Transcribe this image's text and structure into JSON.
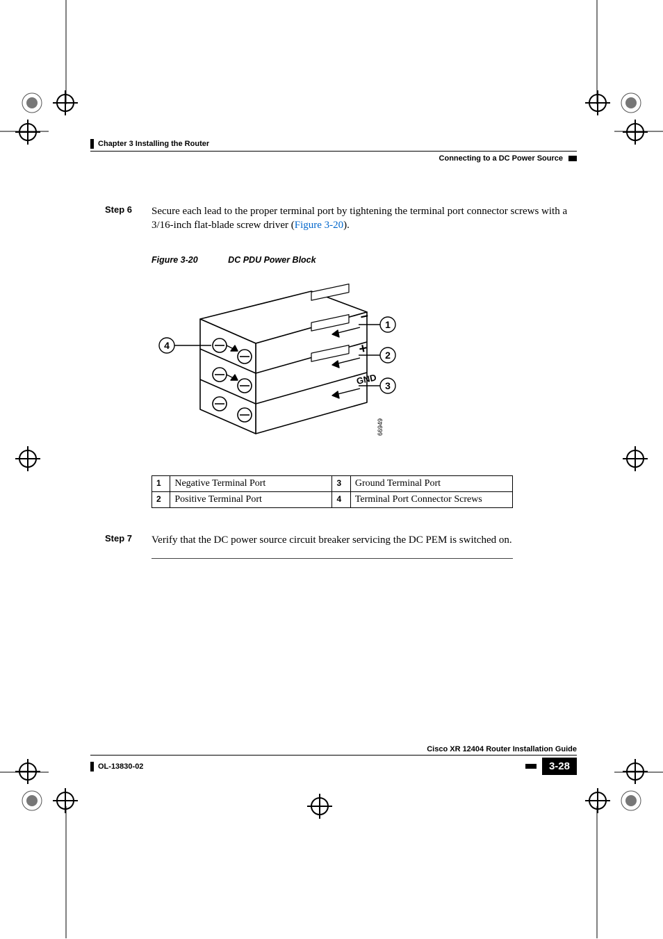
{
  "header": {
    "chapter": "Chapter 3      Installing the Router",
    "section": "Connecting to a DC Power Source"
  },
  "steps": {
    "step6": {
      "label": "Step 6",
      "text_before_link": "Secure each lead to the proper terminal port by tightening the terminal port connector screws with a 3/16-inch flat-blade screw driver (",
      "link_text": "Figure 3-20",
      "text_after_link": ")."
    },
    "step7": {
      "label": "Step 7",
      "text": "Verify that the DC power source circuit breaker servicing the DC PEM is switched on."
    }
  },
  "figure": {
    "number": "Figure 3-20",
    "title": "DC PDU Power Block",
    "callouts": {
      "c1": "1",
      "c2": "2",
      "c3": "3",
      "c4": "4"
    },
    "labels": {
      "minus": "−",
      "plus": "+",
      "gnd": "GND"
    },
    "art_id": "66949"
  },
  "legend": {
    "r1c1_num": "1",
    "r1c1_desc": "Negative Terminal Port",
    "r1c2_num": "3",
    "r1c2_desc": "Ground Terminal Port",
    "r2c1_num": "2",
    "r2c1_desc": "Positive Terminal Port",
    "r2c2_num": "4",
    "r2c2_desc": "Terminal Port Connector Screws"
  },
  "footer": {
    "guide": "Cisco XR 12404 Router Installation Guide",
    "doc_id": "OL-13830-02",
    "page_num": "3-28"
  }
}
